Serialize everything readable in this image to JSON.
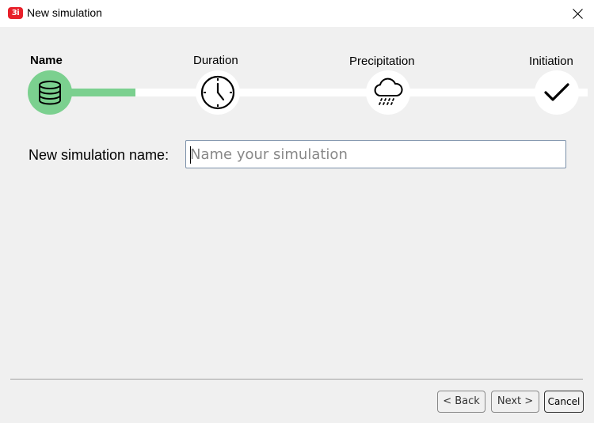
{
  "window": {
    "logo_text": "3i",
    "title": "New simulation",
    "close_icon": "close-icon"
  },
  "stepper": {
    "steps": [
      {
        "label": "Name",
        "icon": "database-icon",
        "active": true
      },
      {
        "label": "Duration",
        "icon": "clock-icon",
        "active": false
      },
      {
        "label": "Precipitation",
        "icon": "rain-cloud-icon",
        "active": false
      },
      {
        "label": "Initiation",
        "icon": "checkmark-icon",
        "active": false
      }
    ],
    "progress_fraction": 0.16,
    "colors": {
      "active": "#7bd08f",
      "inactive": "#ffffff"
    }
  },
  "form": {
    "name_label": "New simulation name:",
    "name_value": "",
    "name_placeholder": "Name your simulation"
  },
  "footer": {
    "back_label": "< Back",
    "next_label": "Next >",
    "cancel_label": "Cancel"
  }
}
